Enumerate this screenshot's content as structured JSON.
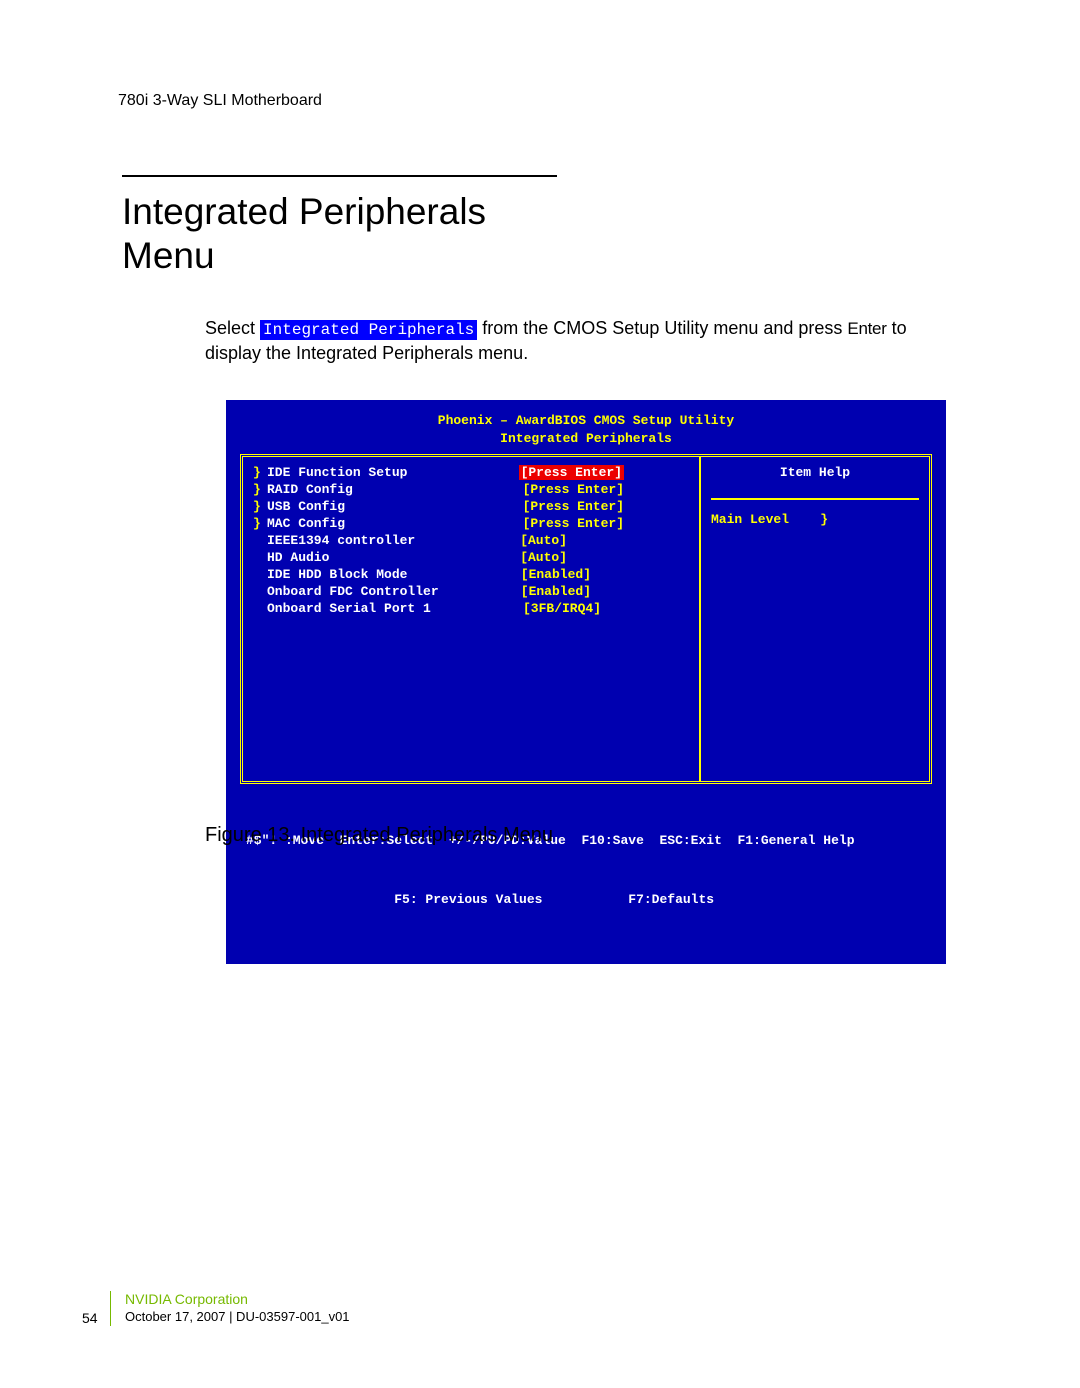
{
  "header": "780i 3-Way SLI Motherboard",
  "title": "Integrated Peripherals Menu",
  "body_pre": "Select ",
  "body_hl": "Integrated Peripherals",
  "body_mid": " from the CMOS Setup Utility menu and press ",
  "body_enter": "Enter",
  "body_post": " to display the Integrated Peripherals menu.",
  "bios": {
    "header_line1": "Phoenix – AwardBIOS CMOS Setup Utility",
    "header_line2": "Integrated Peripherals",
    "rows": [
      {
        "marker": "}",
        "label": "IDE Function Setup",
        "value": "[Press Enter]",
        "red": true
      },
      {
        "marker": "}",
        "label": "RAID Config",
        "value": "[Press Enter]"
      },
      {
        "marker": "}",
        "label": "USB Config",
        "value": "[Press Enter]"
      },
      {
        "marker": "}",
        "label": "MAC Config",
        "value": "[Press Enter]"
      },
      {
        "marker": "",
        "label": "IEEE1394 controller",
        "value": "[Auto]"
      },
      {
        "marker": "",
        "label": "HD Audio",
        "value": "[Auto]"
      },
      {
        "marker": "",
        "label": "IDE HDD Block Mode",
        "value": "[Enabled]"
      },
      {
        "marker": "",
        "label": "Onboard FDC Controller",
        "value": "[Enabled]"
      },
      {
        "marker": "",
        "label": "Onboard Serial Port 1",
        "value": "[3FB/IRQ4]"
      }
    ],
    "help_title": "Item Help",
    "help_level": "Main Level    }",
    "footer1": "#$\"! :Move  Enter:Select  +/-/PU/PD:Value  F10:Save  ESC:Exit  F1:General Help",
    "footer2": "                   F5: Previous Values           F7:Defaults"
  },
  "figure_caption": "Figure 13.    Integrated Peripherals Menu",
  "footer_corp": "NVIDIA Corporation",
  "footer_date": "October 17, 2007 | DU-03597-001_v01",
  "page_num": "54"
}
